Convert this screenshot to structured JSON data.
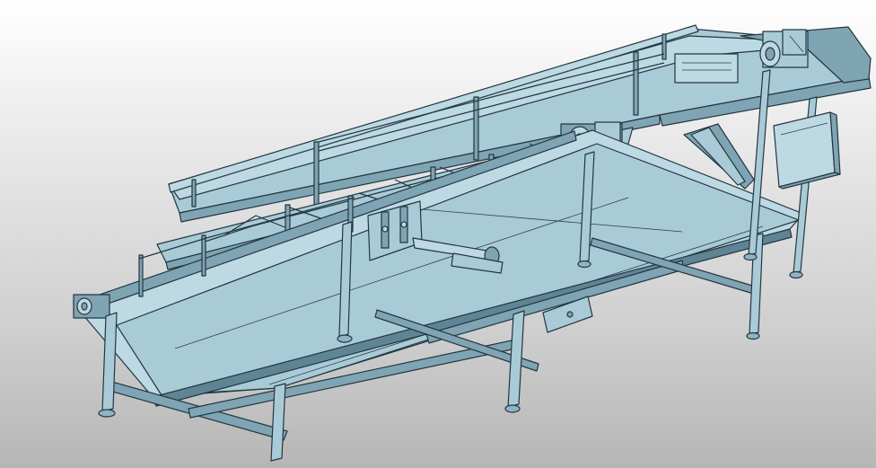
{
  "scene": {
    "subject": "conveyor-assembly",
    "colors": {
      "background_top": "#ffffff",
      "background_bottom": "#b6b6b6",
      "steel": "#a9cbd8",
      "steel_light": "#bcd9e4",
      "steel_dark": "#7fa4b4",
      "edge": "#24363f"
    }
  }
}
